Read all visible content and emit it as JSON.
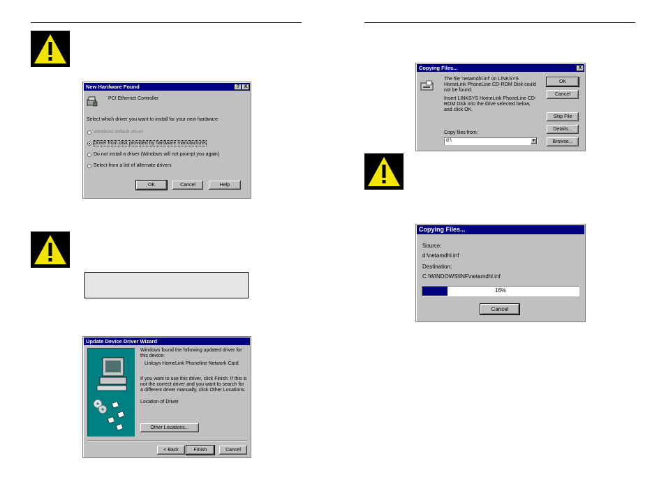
{
  "new_hardware": {
    "title": "New Hardware Found",
    "help_btn": "?",
    "close_btn": "X",
    "device": "PCI Ethernet Controller",
    "prompt": "Select which driver you want to install for your new hardware:",
    "options": [
      {
        "label": "Windows default driver",
        "selected": false,
        "disabled": true
      },
      {
        "label": "Driver from disk provided by hardware manufacturer",
        "selected": true,
        "disabled": false
      },
      {
        "label": "Do not install a driver (Windows will not prompt you again)",
        "selected": false,
        "disabled": false
      },
      {
        "label": "Select from a list of alternate drivers",
        "selected": false,
        "disabled": false
      }
    ],
    "ok": "OK",
    "cancel": "Cancel",
    "help": "Help"
  },
  "update_wizard": {
    "title": "Update Device Driver Wizard",
    "found_text": "Windows found the following updated driver for this device:",
    "device": "Linksys HomeLink Phoneline Network Card",
    "instructions": "If you want to use this driver, click Finish. If this is not the correct driver and you want to search for a different driver manually, click Other Locations.",
    "location_label": "Location of Driver",
    "other_locations": "Other Locations...",
    "back": "< Back",
    "finish": "Finish",
    "cancel": "Cancel"
  },
  "copy_dialog": {
    "title": "Copying Files...",
    "close_btn": "X",
    "message1": "The file 'netamdhl.inf' on LINKSYS HomeLink PhoneLine CD-ROM Disk could not be found.",
    "message2": "Insert LINKSYS HomeLink PhoneLine CD-ROM Disk into the drive selected below, and click OK.",
    "copy_from_label": "Copy files from:",
    "copy_from_value": "d:\\",
    "ok": "OK",
    "cancel": "Cancel",
    "skip": "Skip File",
    "details": "Details...",
    "browse": "Browse..."
  },
  "copy_progress": {
    "title": "Copying Files...",
    "source_label": "Source:",
    "source_value": "d:\\netamdhl.inf",
    "dest_label": "Destination:",
    "dest_value": "C:\\WINDOWS\\INF\\netamdhl.inf",
    "progress_text": "16%",
    "progress_fraction": 0.16,
    "cancel": "Cancel"
  }
}
